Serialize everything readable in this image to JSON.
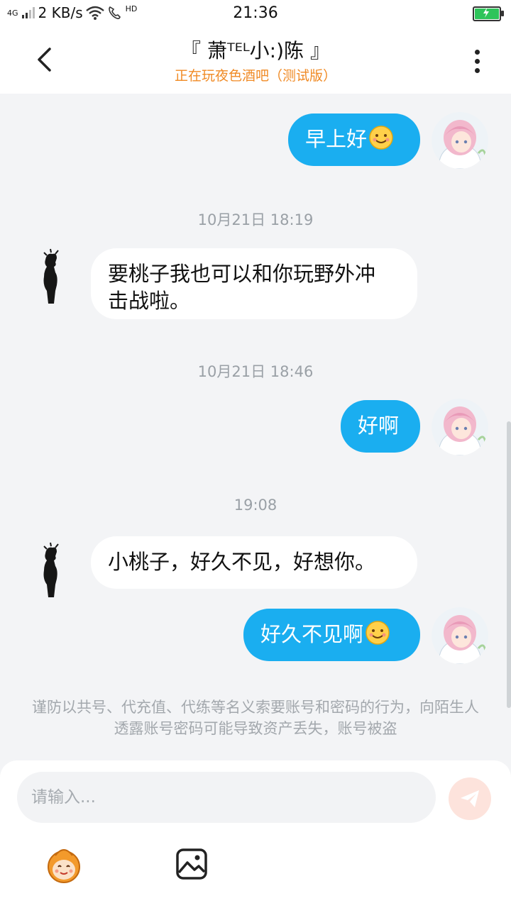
{
  "status_bar": {
    "network": "4G",
    "speed": "2 KB/s",
    "hd": "HD",
    "time": "21:36"
  },
  "header": {
    "title": "『 萧ᵀᴱᴸ小:)陈 』",
    "subtitle": "正在玩夜色酒吧（测试版）"
  },
  "messages": [
    {
      "sender": "me",
      "text": "早上好",
      "emoji": "smile-emoji"
    },
    {
      "timestamp": "10月21日 18:19"
    },
    {
      "sender": "other",
      "text_line1": "要桃子我也可以和你玩野外冲",
      "text_line2": "击战啦。"
    },
    {
      "timestamp": "10月21日 18:46"
    },
    {
      "sender": "me",
      "text": "好啊"
    },
    {
      "timestamp": "19:08"
    },
    {
      "sender": "other",
      "text": "小桃子，好久不见，好想你。"
    },
    {
      "sender": "me",
      "text": "好久不见啊",
      "emoji": "smile-emoji"
    }
  ],
  "notice": "谨防以共号、代充值、代练等名义索要账号和密码的行为，向陌生人透露账号密码可能导致资产丢失，账号被盗",
  "input": {
    "placeholder": "请输入..."
  },
  "colors": {
    "my_bubble": "#1aaef0",
    "other_bubble": "#ffffff",
    "subtitle": "#f08a24",
    "background": "#f3f4f6"
  },
  "icons": [
    "back-chevron-icon",
    "more-dots-icon",
    "send-icon",
    "emoji-icon",
    "image-icon",
    "my-avatar",
    "other-avatar"
  ]
}
